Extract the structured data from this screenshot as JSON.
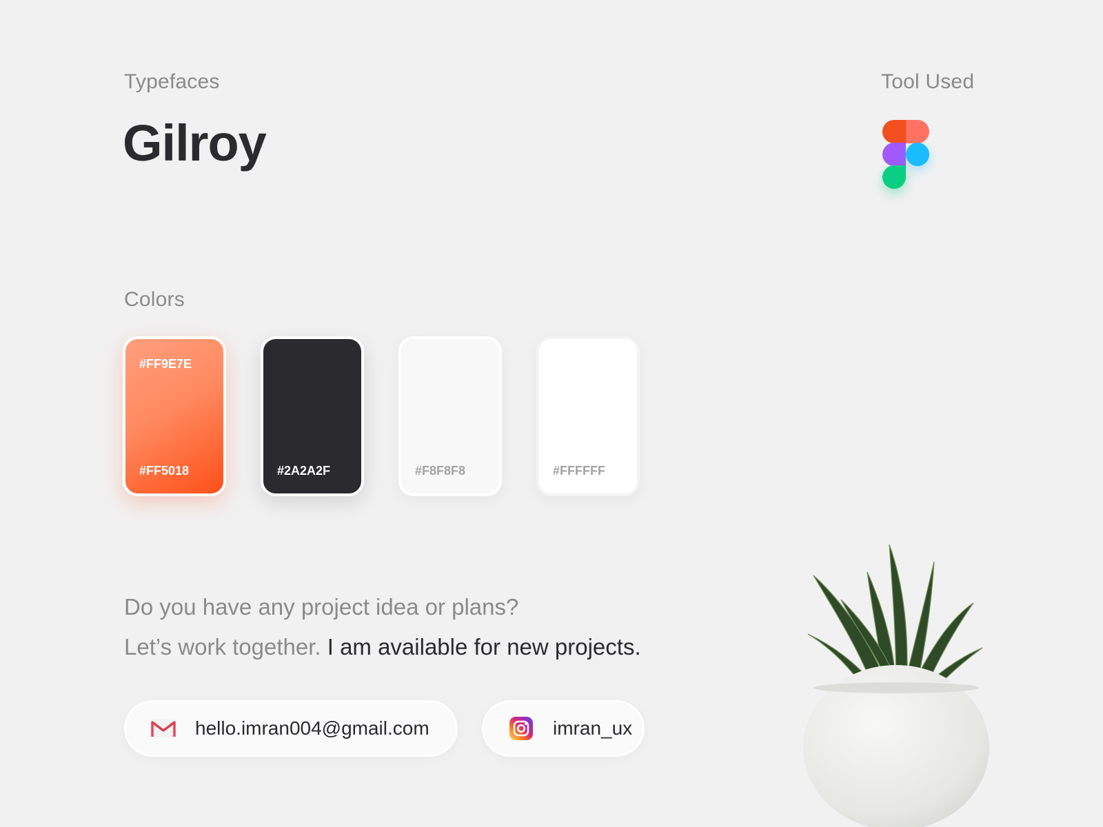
{
  "typefaces": {
    "label": "Typefaces",
    "name": "Gilroy"
  },
  "tool": {
    "label": "Tool Used",
    "icon": "figma-icon"
  },
  "colors": {
    "label": "Colors",
    "swatches": [
      {
        "top_label": "#FF9E7E",
        "bottom_label": "#FF5018",
        "gradient_from": "#FF9E7E",
        "gradient_to": "#FF5018"
      },
      {
        "bottom_label": "#2A2A2F",
        "color": "#2A2A2F"
      },
      {
        "bottom_label": "#F8F8F8",
        "color": "#F8F8F8"
      },
      {
        "bottom_label": "#FFFFFF",
        "color": "#FFFFFF"
      }
    ]
  },
  "cta": {
    "line1": "Do you have any project idea or plans?",
    "line2_muted": "Let’s work together.",
    "line2_emphasis": "I am available for new projects."
  },
  "contacts": {
    "email": {
      "icon": "gmail-icon",
      "text": "hello.imran004@gmail.com"
    },
    "instagram": {
      "icon": "instagram-icon",
      "text": "imran_ux"
    }
  },
  "decor": {
    "image": "potted-succulent-plant"
  }
}
